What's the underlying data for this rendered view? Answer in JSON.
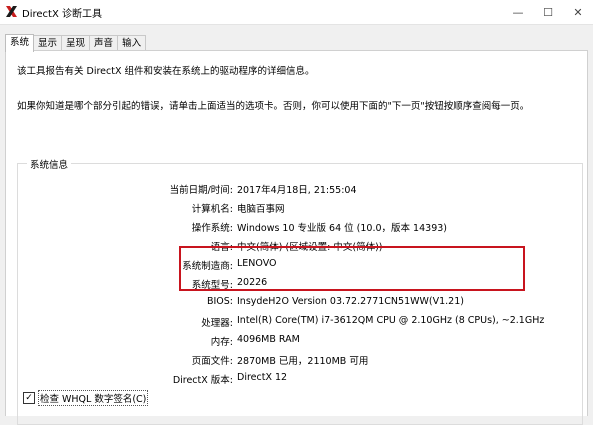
{
  "window": {
    "title": "DirectX 诊断工具",
    "controls": {
      "minimize": "—",
      "maximize": "☐",
      "close": "✕"
    },
    "icon": "directx-x-icon",
    "icon_color": "#c81e1e"
  },
  "tabs": [
    {
      "label": "系统",
      "active": true
    },
    {
      "label": "显示",
      "active": false
    },
    {
      "label": "呈现",
      "active": false
    },
    {
      "label": "声音",
      "active": false
    },
    {
      "label": "输入",
      "active": false
    }
  ],
  "intro": {
    "line1": "该工具报告有关 DirectX 组件和安装在系统上的驱动程序的详细信息。",
    "line2": "如果你知道是哪个部分引起的错误，请单击上面适当的选项卡。否则，你可以使用下面的\"下一页\"按钮按顺序查阅每一页。"
  },
  "system_info": {
    "group_label": "系统信息",
    "rows": [
      {
        "label": "当前日期/时间:",
        "value": "2017年4月18日, 21:55:04"
      },
      {
        "label": "计算机名:",
        "value": "电脑百事网"
      },
      {
        "label": "操作系统:",
        "value": "Windows 10 专业版 64 位 (10.0，版本 14393)"
      },
      {
        "label": "语言:",
        "value": "中文(简体) (区域设置: 中文(简体))"
      },
      {
        "label": "系统制造商:",
        "value": "LENOVO"
      },
      {
        "label": "系统型号:",
        "value": "20226"
      },
      {
        "label": "BIOS:",
        "value": "InsydeH2O Version 03.72.2771CN51WW(V1.21)"
      },
      {
        "label": "处理器:",
        "value": "Intel(R) Core(TM) i7-3612QM CPU @ 2.10GHz (8 CPUs), ~2.1GHz"
      },
      {
        "label": "内存:",
        "value": "4096MB RAM"
      },
      {
        "label": "页面文件:",
        "value": "2870MB 已用，2110MB 可用"
      },
      {
        "label": "DirectX 版本:",
        "value": "DirectX 12"
      }
    ]
  },
  "whql": {
    "checked": true,
    "label": "检查 WHQL 数字签名(C)",
    "check_glyph": "✓"
  },
  "colors": {
    "highlight_border": "#c8141e"
  }
}
